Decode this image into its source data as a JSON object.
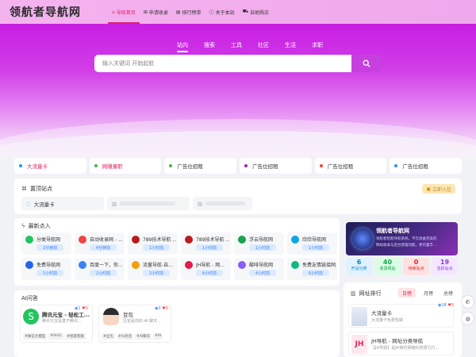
{
  "header": {
    "logo": "领航者导航网",
    "nav": [
      {
        "label": "导航首页",
        "icon": "home-icon",
        "glyph": "⌂",
        "active": true
      },
      {
        "label": "申请收录",
        "icon": "plus-square-icon",
        "glyph": "⊞",
        "active": false
      },
      {
        "label": "排行榜单",
        "icon": "chart-icon",
        "glyph": "▤",
        "active": false
      },
      {
        "label": "关于本站",
        "icon": "info-icon",
        "glyph": "ⓘ",
        "active": false
      },
      {
        "label": "自助购买",
        "icon": "cart-icon",
        "glyph": "⛟",
        "active": false
      }
    ]
  },
  "hero": {
    "tabs": [
      "站内",
      "搜索",
      "工具",
      "社区",
      "生活",
      "求职"
    ],
    "active_tab": "站内",
    "search_placeholder": "输入关键词 开始起航"
  },
  "quick_links": [
    {
      "label": "大流量卡",
      "dot": "#2196f3",
      "color": "#e0245e"
    },
    {
      "label": "网赚兼职",
      "dot": "#4caf50",
      "color": "#e0245e"
    },
    {
      "label": "广告位招租",
      "dot": "#4caf50",
      "color": "#333333"
    },
    {
      "label": "广告位招租",
      "dot": "#9c27b0",
      "color": "#333333"
    },
    {
      "label": "广告位招租",
      "dot": "#f44336",
      "color": "#333333"
    },
    {
      "label": "广告位招租",
      "dot": "#2196f3",
      "color": "#333333"
    }
  ],
  "pinned": {
    "title": "置顶站点",
    "add_label": "立即入驻",
    "items": [
      {
        "label": "大流量卡"
      }
    ]
  },
  "latest": {
    "title": "最新点入",
    "sites": [
      {
        "name": "分类导航网",
        "time": "2分钟前",
        "color": "#22c55e"
      },
      {
        "name": "自动收录网 - ...",
        "time": "4分钟前",
        "color": "#ef4444"
      },
      {
        "name": "789技术导航 ...",
        "time": "1小时前",
        "color": "#b91c1c"
      },
      {
        "name": "789技术导航 ...",
        "time": "1小时前",
        "color": "#b91c1c"
      },
      {
        "name": "浮云导航网",
        "time": "1小时前",
        "color": "#16a34a"
      },
      {
        "name": "欣欣导航网",
        "time": "1小时前",
        "color": "#0ea5e9"
      },
      {
        "name": "免费导航网",
        "time": "1小时前",
        "color": "#2563eb"
      },
      {
        "name": "百度一下，你...",
        "time": "2小时前",
        "color": "#3b82f6"
      },
      {
        "name": "流量导航-自...",
        "time": "2小时前",
        "color": "#f59e0b"
      },
      {
        "name": "JH导航 - 网...",
        "time": "4小时前",
        "color": "#e11d48"
      },
      {
        "name": "酸啡导航网",
        "time": "4小时前",
        "color": "#8b5cf6"
      },
      {
        "name": "免费友情链接网",
        "time": "6小时前",
        "color": "#10b981"
      }
    ]
  },
  "promo": {
    "title": "领航者导航网",
    "lines": [
      "领航者智能导航系统，不仅具备完美的",
      "网站收录与后台管理功能，更内置丰..."
    ]
  },
  "stats": [
    {
      "num": "6",
      "label": "开设分类",
      "bg": "#e0f2fe",
      "color": "#0284c7"
    },
    {
      "num": "40",
      "label": "收录网站",
      "bg": "#dcfce7",
      "color": "#16a34a"
    },
    {
      "num": "0",
      "label": "待审站点",
      "bg": "#fee2e2",
      "color": "#dc2626"
    },
    {
      "num": "19",
      "label": "活跃站点",
      "bg": "#f3e8ff",
      "color": "#9333ea"
    }
  ],
  "ai": {
    "title": "AI问答",
    "items": [
      {
        "name": "腾讯元宝 - 轻松工...",
        "desc": "腾讯元宝是基于腾讯...",
        "views": "1",
        "likes": "0",
        "tags": [
          "#微信大模型",
          "#AIGC",
          "#智能客服"
        ]
      },
      {
        "name": "豆包",
        "desc": "豆包是你的 AI 聊天...",
        "views": "0",
        "likes": "0",
        "tags": [
          "#豆包",
          "#AI对话",
          "#AI聊天",
          "#AI"
        ]
      }
    ]
  },
  "rank": {
    "title": "网址排行",
    "tabs": [
      "日榜",
      "月榜",
      "总榜"
    ],
    "items": [
      {
        "name": "大流量卡",
        "desc": "大流量卡免费包邮",
        "views": "18",
        "likes": "5"
      },
      {
        "name": "JH导航 - 网址分类导航",
        "desc": "【JH导航】是JH简约网络科技倾力打...",
        "views": "",
        "likes": ""
      }
    ]
  },
  "float": [
    "contact-icon",
    "wechat-icon"
  ]
}
